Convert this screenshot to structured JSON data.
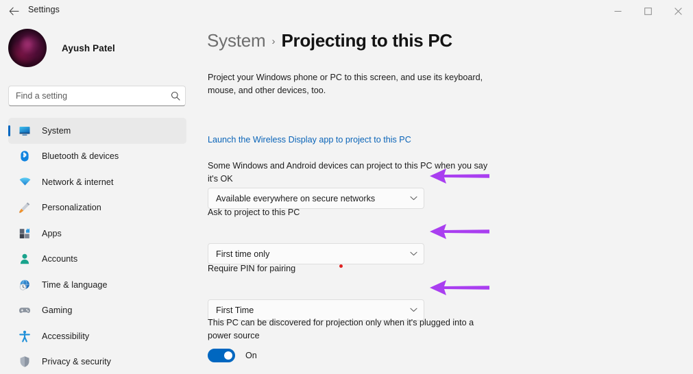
{
  "window": {
    "title": "Settings",
    "back_icon": "back-arrow-icon",
    "minimize_label": "—",
    "maximize_label": "☐",
    "close_label": "✕"
  },
  "sidebar": {
    "profile": {
      "name": "Ayush Patel",
      "avatar_icon": "user-avatar"
    },
    "search": {
      "placeholder": "Find a setting",
      "value": "",
      "icon": "search-icon"
    },
    "items": [
      {
        "label": "System",
        "icon": "monitor-icon",
        "selected": true
      },
      {
        "label": "Bluetooth & devices",
        "icon": "bluetooth-icon",
        "selected": false
      },
      {
        "label": "Network & internet",
        "icon": "wifi-icon",
        "selected": false
      },
      {
        "label": "Personalization",
        "icon": "paintbrush-icon",
        "selected": false
      },
      {
        "label": "Apps",
        "icon": "apps-grid-icon",
        "selected": false
      },
      {
        "label": "Accounts",
        "icon": "person-icon",
        "selected": false
      },
      {
        "label": "Time & language",
        "icon": "clock-globe-icon",
        "selected": false
      },
      {
        "label": "Gaming",
        "icon": "game-controller-icon",
        "selected": false
      },
      {
        "label": "Accessibility",
        "icon": "accessibility-person-icon",
        "selected": false
      },
      {
        "label": "Privacy & security",
        "icon": "shield-icon",
        "selected": false
      }
    ]
  },
  "main": {
    "breadcrumb": {
      "parent": "System",
      "separator": "›",
      "current": "Projecting to this PC"
    },
    "intro": "Project your Windows phone or PC to this screen, and use its keyboard, mouse, and other devices, too.",
    "launch_link": "Launch the Wireless Display app to project to this PC",
    "settings": [
      {
        "label": "Some Windows and Android devices can project to this PC when you say it's OK",
        "value": "Available everywhere on secure networks",
        "chevron": "chevron-down-icon"
      },
      {
        "label": "Ask to project to this PC",
        "value": "First time only",
        "chevron": "chevron-down-icon"
      },
      {
        "label": "Require PIN for pairing",
        "value": "First Time",
        "chevron": "chevron-down-icon"
      }
    ],
    "power_setting": {
      "label": "This PC can be discovered for projection only when it's plugged into a power source",
      "toggle_state": "On"
    }
  },
  "annotations": {
    "arrow_color": "#a93ef0",
    "arrows": [
      {
        "name": "arrow-pointing-availability-dropdown"
      },
      {
        "name": "arrow-pointing-ask-to-project-dropdown"
      },
      {
        "name": "arrow-pointing-require-pin-dropdown"
      }
    ],
    "red_dot_color": "#e02222"
  },
  "colors": {
    "accent": "#0067c0",
    "link": "#0a64b8",
    "window_bg": "#f3f3f3",
    "selected_nav_bg": "#e9e9e9"
  }
}
